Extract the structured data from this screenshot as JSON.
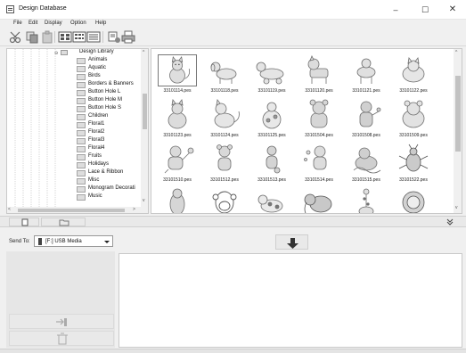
{
  "window": {
    "title": "Design Database",
    "controls": {
      "minimize": "–",
      "maximize": "☐",
      "close": "✕"
    }
  },
  "menu": [
    "File",
    "Edit",
    "Display",
    "Option",
    "Help"
  ],
  "toolbar": {
    "buttons": [
      "cut-icon",
      "copy-icon",
      "paste-icon",
      "large-thumbnails-icon",
      "medium-thumbnails-icon",
      "list-view-icon",
      "properties-icon",
      "print-icon"
    ]
  },
  "tree": {
    "root": "Design Library",
    "items": [
      "Animals",
      "Aquatic",
      "Birds",
      "Borders & Banners",
      "Button Hole L",
      "Button Hole M",
      "Button Hole S",
      "Children",
      "Floral1",
      "Floral2",
      "Floral3",
      "Floral4",
      "Fruits",
      "Holidays",
      "Lace & Ribbon",
      "Misc",
      "Monogram Decorati",
      "Music"
    ]
  },
  "files": {
    "row1": [
      "33101114.pes",
      "33101118.pes",
      "33101119.pes",
      "33101120.pes",
      "33101121.pes",
      "33101122.pes"
    ],
    "row2": [
      "33101123.pes",
      "33101124.pes",
      "33101125.pes",
      "33101504.pes",
      "33101508.pes",
      "33101509.pes"
    ],
    "row3": [
      "33101510.pes",
      "33101512.pes",
      "33101513.pes",
      "33101514.pes",
      "33101515.pes",
      "33101522.pes"
    ],
    "row4": [
      "",
      "",
      "",
      "",
      "",
      ""
    ]
  },
  "send": {
    "label": "Send To:",
    "selected": "[F:] USB Media"
  },
  "colors": {
    "window_bg": "#f0f0f0",
    "pane_bg": "#ffffff",
    "border": "#c9c9c9",
    "design_stroke": "#808080"
  }
}
